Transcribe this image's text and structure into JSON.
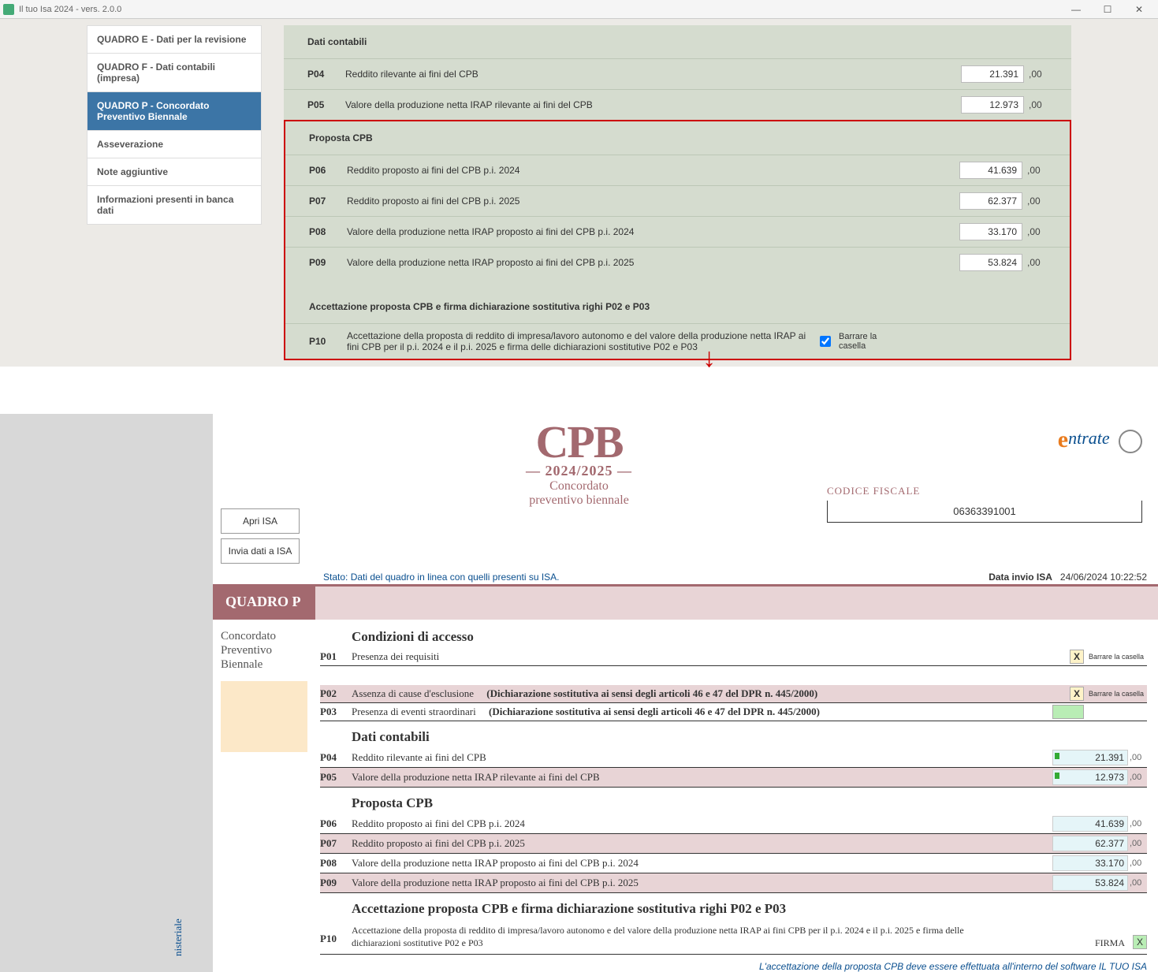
{
  "window": {
    "title": "Il tuo Isa 2024 - vers. 2.0.0",
    "min": "—",
    "max": "☐",
    "close": "✕"
  },
  "sidebar": {
    "items": [
      "QUADRO E - Dati per la revisione",
      "QUADRO F - Dati contabili (impresa)",
      "QUADRO P - Concordato Preventivo Biennale",
      "Asseverazione",
      "Note aggiuntive",
      "Informazioni presenti in banca dati"
    ]
  },
  "upper": {
    "dati_contabili": {
      "title": "Dati contabili",
      "rows": [
        {
          "code": "P04",
          "label": "Reddito rilevante ai fini del CPB",
          "value": "21.391",
          "dec": ",00"
        },
        {
          "code": "P05",
          "label": "Valore della produzione netta IRAP rilevante ai fini del CPB",
          "value": "12.973",
          "dec": ",00"
        }
      ]
    },
    "proposta": {
      "title": "Proposta CPB",
      "rows": [
        {
          "code": "P06",
          "label": "Reddito proposto ai fini del CPB p.i. 2024",
          "value": "41.639",
          "dec": ",00"
        },
        {
          "code": "P07",
          "label": "Reddito proposto ai fini del CPB p.i. 2025",
          "value": "62.377",
          "dec": ",00"
        },
        {
          "code": "P08",
          "label": "Valore della produzione netta IRAP proposto ai fini del CPB p.i. 2024",
          "value": "33.170",
          "dec": ",00"
        },
        {
          "code": "P09",
          "label": "Valore della produzione netta IRAP proposto ai fini del CPB p.i. 2025",
          "value": "53.824",
          "dec": ",00"
        }
      ],
      "accett_title": "Accettazione proposta CPB e firma dichiarazione sostitutiva righi P02 e P03",
      "p10_code": "P10",
      "p10_label": "Accettazione della proposta di reddito di impresa/lavoro autonomo e del valore della produzione netta IRAP ai fini CPB per il p.i. 2024 e il p.i. 2025 e firma delle dichiarazioni sostitutive P02 e P03",
      "p10_hint": "Barrare la casella"
    }
  },
  "lower": {
    "cpb": {
      "logo": "CPB",
      "years": "2024/2025",
      "sub1": "Concordato",
      "sub2": "preventivo biennale"
    },
    "buttons": {
      "apri": "Apri ISA",
      "invia": "Invia dati a ISA"
    },
    "agenzia": "ntrate",
    "cf_label": "CODICE FISCALE",
    "cf_value": "06363391001",
    "status": "Stato: Dati del quadro in linea con quelli presenti su ISA.",
    "data_invio_lbl": "Data invio ISA",
    "data_invio_val": "24/06/2024 10:22:52",
    "quadro_p": "QUADRO P",
    "subtitle": "Concordato Preventivo Biennale",
    "sections": {
      "cond": {
        "title": "Condizioni di accesso",
        "p01": {
          "code": "P01",
          "label": "Presenza dei requisiti",
          "x": "X",
          "hint": "Barrare la casella"
        },
        "p02": {
          "code": "P02",
          "label": "Assenza di cause d'esclusione",
          "paren": "(Dichiarazione sostitutiva ai sensi degli articoli 46 e 47 del DPR n. 445/2000)",
          "x": "X",
          "hint": "Barrare la casella"
        },
        "p03": {
          "code": "P03",
          "label": "Presenza di eventi straordinari",
          "paren": "(Dichiarazione sostitutiva ai sensi degli articoli 46 e 47 del DPR n. 445/2000)"
        }
      },
      "dati": {
        "title": "Dati contabili",
        "rows": [
          {
            "code": "P04",
            "label": "Reddito rilevante ai fini del CPB",
            "value": "21.391",
            "dec": ",00",
            "marker": true
          },
          {
            "code": "P05",
            "label": "Valore della produzione netta IRAP rilevante ai fini del CPB",
            "value": "12.973",
            "dec": ",00",
            "marker": true
          }
        ]
      },
      "prop": {
        "title": "Proposta CPB",
        "rows": [
          {
            "code": "P06",
            "label": "Reddito proposto ai fini del CPB p.i. 2024",
            "value": "41.639",
            "dec": ",00"
          },
          {
            "code": "P07",
            "label": "Reddito proposto ai fini del CPB p.i. 2025",
            "value": "62.377",
            "dec": ",00"
          },
          {
            "code": "P08",
            "label": "Valore della produzione netta IRAP proposto ai fini del CPB p.i. 2024",
            "value": "33.170",
            "dec": ",00"
          },
          {
            "code": "P09",
            "label": "Valore della produzione netta IRAP proposto ai fini del CPB p.i. 2025",
            "value": "53.824",
            "dec": ",00"
          }
        ]
      },
      "accett": {
        "title": "Accettazione proposta CPB e firma dichiarazione sostitutiva righi P02 e P03",
        "p10_code": "P10",
        "p10_desc": "Accettazione della proposta di reddito di impresa/lavoro autonomo e del valore della produzione netta IRAP ai fini CPB per il p.i. 2024 e il p.i. 2025 e firma delle dichiarazioni sostitutive P02 e P03",
        "firma_lbl": "FIRMA",
        "firma_x": "X"
      }
    },
    "footer": "L'accettazione della proposta CPB deve essere effettuata all'interno del software IL TUO ISA",
    "vertical": "nisteriale"
  }
}
